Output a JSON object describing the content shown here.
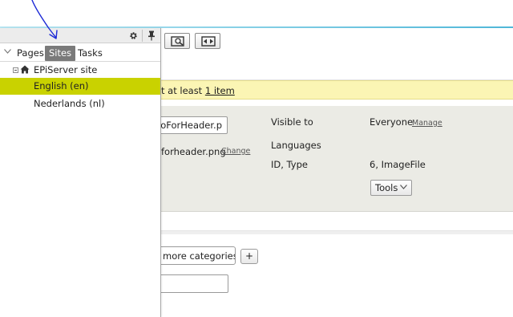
{
  "panel": {
    "toolbar": {
      "settings_icon": "gear-icon",
      "pin_icon": "pin-icon"
    },
    "tabs": [
      {
        "label": "Pages",
        "active": false
      },
      {
        "label": "Sites",
        "active": true
      },
      {
        "label": "Tasks",
        "active": false
      }
    ],
    "tree": [
      {
        "label": "EPiServer site",
        "icon": "home-icon",
        "expanded": true
      },
      {
        "label": "English (en)",
        "selected": true
      },
      {
        "label": "Nederlands (nl)",
        "selected": false
      }
    ],
    "selected_color": "#c9d200"
  },
  "toolbar": {
    "preview_icon": "preview-icon",
    "compare_icon": "compare-icon"
  },
  "notice": {
    "text": "t at least ",
    "link": "1 item"
  },
  "properties": {
    "name_value": "goForHeader.p",
    "filename": "forheader.png",
    "change_link": "Change",
    "visible_to_label": "Visible to",
    "visible_to_value": "Everyone",
    "manage_link": "Manage",
    "languages_label": "Languages",
    "id_type_label": "ID, Type",
    "id_type_value": "6, ImageFile",
    "tools_label": "Tools"
  },
  "categories": {
    "button_label": "more categories",
    "add_label": "+"
  },
  "annotation_color": "#1d2ad6"
}
